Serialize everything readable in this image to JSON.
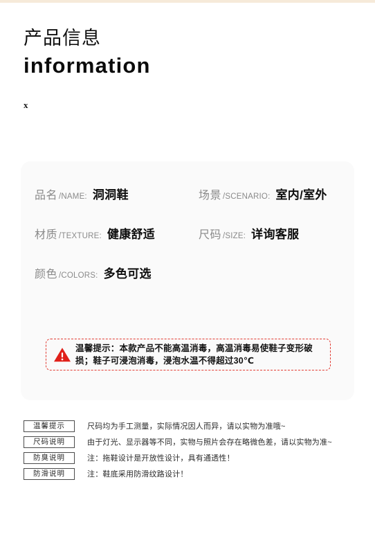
{
  "page": {
    "top_band_color": "#f6ead9",
    "panel_color": "#fafafa",
    "accent_red": "#e23b32"
  },
  "heading": {
    "title_cn": "产品信息",
    "title_en": "information",
    "mark": "x"
  },
  "specs": [
    [
      {
        "label_cn": "品名",
        "label_en": "/NAME:",
        "value": "洞洞鞋"
      },
      {
        "label_cn": "场景",
        "label_en": "/SCENARIO:",
        "value": "室内/室外"
      }
    ],
    [
      {
        "label_cn": "材质",
        "label_en": "/TEXTURE:",
        "value": "健康舒适"
      },
      {
        "label_cn": "尺码",
        "label_en": "/SIZE:",
        "value": "详询客服"
      }
    ],
    [
      {
        "label_cn": "颜色",
        "label_en": "/COLORS:",
        "value": "多色可选"
      },
      {
        "label_cn": "",
        "label_en": "",
        "value": ""
      }
    ]
  ],
  "warning": {
    "icon": "warning-triangle-icon",
    "text": "温馨提示：本款产品不能高温消毒，高温消毒易使鞋子变形破损；鞋子可浸泡消毒，浸泡水温不得超过30℃"
  },
  "notes": [
    {
      "tag": "温馨提示",
      "text": "尺码均为手工测量，实际情况因人而异，请以实物为准哦~"
    },
    {
      "tag": "尺码说明",
      "text": "由于灯光、显示器等不同，实物与照片会存在略微色差，请以实物为准~"
    },
    {
      "tag": "防臭说明",
      "text": "注：拖鞋设计是开放性设计，具有通透性！"
    },
    {
      "tag": "防滑说明",
      "text": "注：鞋底采用防滑纹路设计！"
    }
  ]
}
